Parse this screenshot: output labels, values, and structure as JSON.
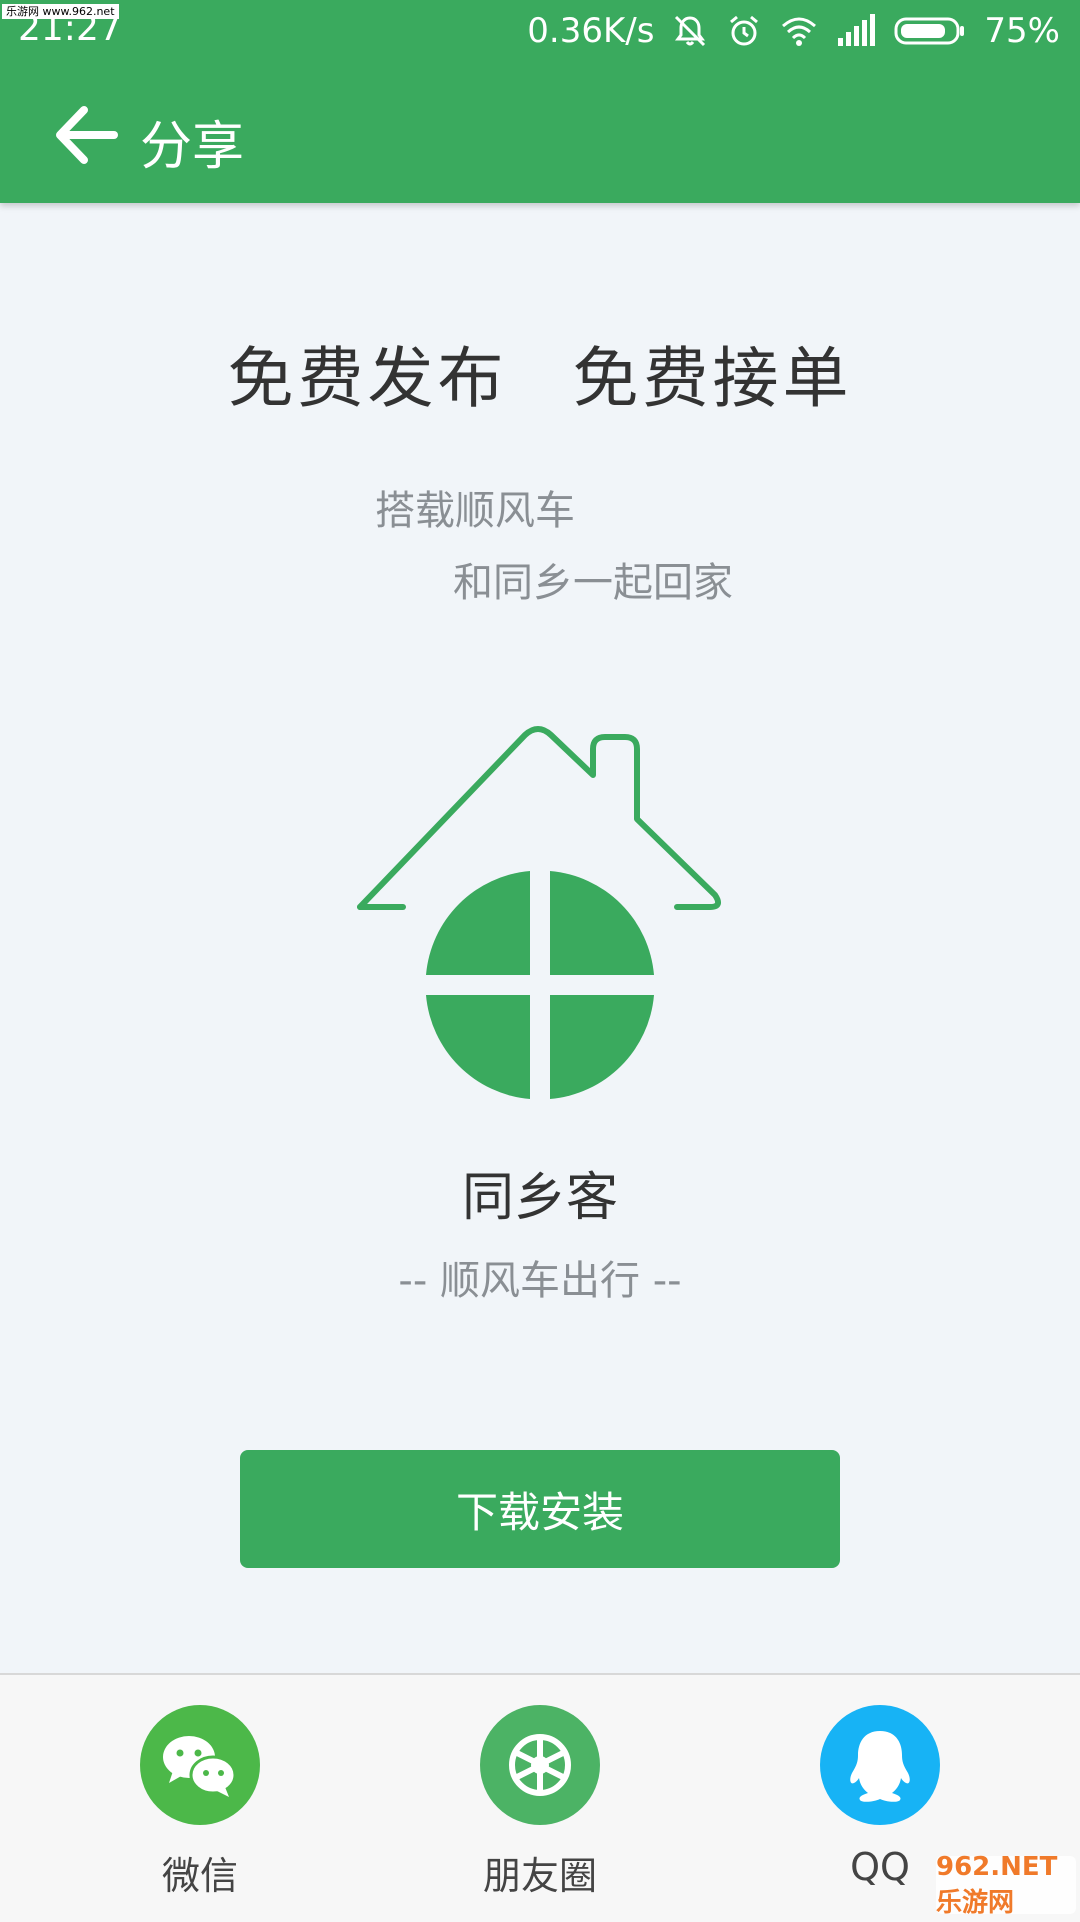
{
  "watermark_top": "乐游网 www.962.net",
  "status_bar": {
    "time": "21:27",
    "speed": "0.36K/s",
    "battery": "75%"
  },
  "toolbar": {
    "title": "分享"
  },
  "main": {
    "headline": "免费发布 免费接单",
    "subtitle_line1": "搭载顺风车",
    "subtitle_line2": "和同乡一起回家",
    "brand_name": "同乡客",
    "slogan": "-- 顺风车出行 --",
    "download_label": "下载安装"
  },
  "share": {
    "items": [
      {
        "label": "微信",
        "icon": "wechat-icon"
      },
      {
        "label": "朋友圈",
        "icon": "moments-icon"
      },
      {
        "label": "QQ",
        "icon": "qq-icon"
      }
    ]
  },
  "watermark_bottom": "962.NET 乐游网",
  "colors": {
    "primary": "#3aaa5e",
    "wechat": "#4cb849",
    "moments": "#4cb365",
    "qq": "#17b3f5",
    "background": "#f1f5f9"
  }
}
